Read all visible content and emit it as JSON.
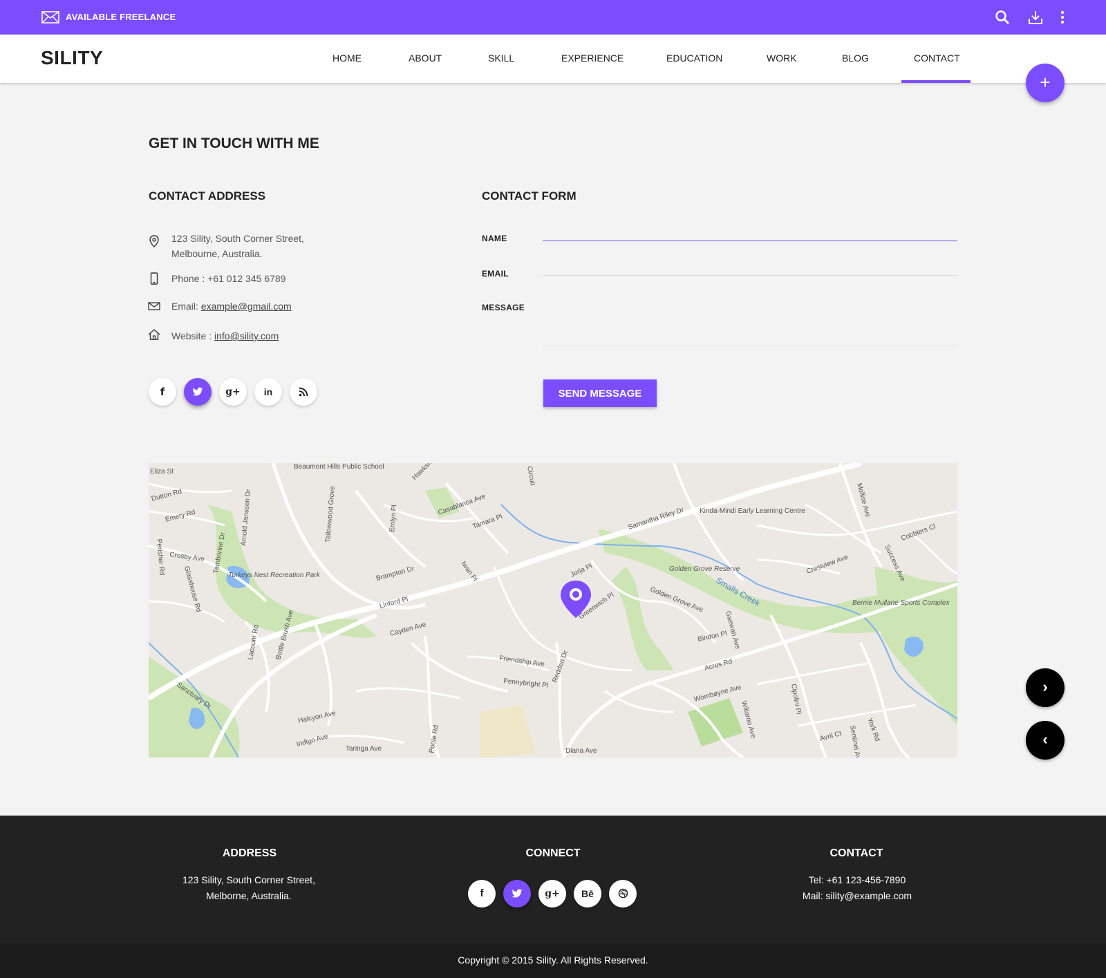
{
  "topbar": {
    "available_label": "AVAILABLE FREELANCE",
    "icons": [
      "mail-icon",
      "search-icon",
      "download-icon",
      "more-vert-icon"
    ]
  },
  "navbar": {
    "brand": "SILITY",
    "items": [
      "HOME",
      "ABOUT",
      "SKILL",
      "EXPERIENCE",
      "EDUCATION",
      "WORK",
      "BLOG",
      "CONTACT"
    ],
    "active": "CONTACT",
    "fab_label": "+"
  },
  "section": {
    "title": "GET IN TOUCH WITH ME",
    "address_heading": "CONTACT ADDRESS",
    "form_heading": "CONTACT FORM"
  },
  "address": {
    "street_line1": "123 Sility, South Corner Street,",
    "street_line2": "Melbourne, Australia.",
    "phone": "Phone : +61 012 345 6789",
    "email_prefix": "Email: ",
    "email": "example@gmail.com",
    "website_prefix": "Website : ",
    "website": "info@sility.com"
  },
  "social": [
    "f",
    "twitter",
    "g+",
    "in",
    "rss"
  ],
  "form": {
    "name_label": "NAME",
    "email_label": "EMAIL",
    "message_label": "MESSAGE",
    "name_value": "",
    "email_value": "",
    "message_value": "",
    "submit_label": "SEND MESSAGE"
  },
  "map": {
    "labels": [
      "Beaumont Hills Public School",
      "Samantha Riley Dr",
      "Kinda-Mindi Early Learning Centre",
      "Turkeys Nest Recreation Park",
      "Golden Grove Reserve",
      "Smalls Creek",
      "Bernie Mullane Sports Complex",
      "Brampton Dr",
      "Linford Pl",
      "Cayden Ave",
      "Friendship Ave",
      "Pennybright Pl",
      "Redden Dr",
      "Greenwich Pl",
      "Jorja Pl",
      "Golden Grove Ave",
      "Crestview Ave",
      "Cobblers Cl",
      "Bindon Pl",
      "Acres Rd",
      "Wombøyne Ave",
      "Halcyon Ave",
      "Indigo Ave",
      "Taringa Ave",
      "Diana Ave",
      "Sanctuary Dr",
      "Emery Rd",
      "Dutton Rd",
      "Crosby Ave",
      "Tamborine Dr",
      "Casablanca Ave",
      "Tamara Pl",
      "Iwan Pl",
      "Lacoom Rd",
      "Bottle Brush Ave",
      "Poole Rd",
      "Eliza St",
      "Avril Ct",
      "York Rd",
      "Cipolini Pl",
      "Willaroo Ave",
      "Gaewan Ave",
      "Success Ave",
      "Mollise Ave",
      "Sentinel Ave",
      "Emlyn Pl",
      "Tallowwood Grove",
      "Arnold Janssen Dr",
      "Glasshouse Rd",
      "Perisher Rd",
      "Hawksh Ct",
      "Circuit"
    ],
    "nav_next": "›",
    "nav_prev": "‹"
  },
  "footer": {
    "address_heading": "ADDRESS",
    "address_line1": "123 Sility, South Corner Street,",
    "address_line2": "Melborne, Australia.",
    "connect_heading": "CONNECT",
    "connect_social": [
      "f",
      "twitter",
      "g+",
      "Bē",
      "dribbble"
    ],
    "contact_heading": "CONTACT",
    "tel": "Tel: +61 123-456-7890",
    "mail": "Mail: sility@example.com",
    "copyright": "Copyright © 2015 Sility. All Rights Reserved."
  },
  "colors": {
    "accent": "#7c4dff",
    "footer": "#222222",
    "footer_bottom": "#1b1b1b",
    "page_bg": "#f3f3f3"
  }
}
